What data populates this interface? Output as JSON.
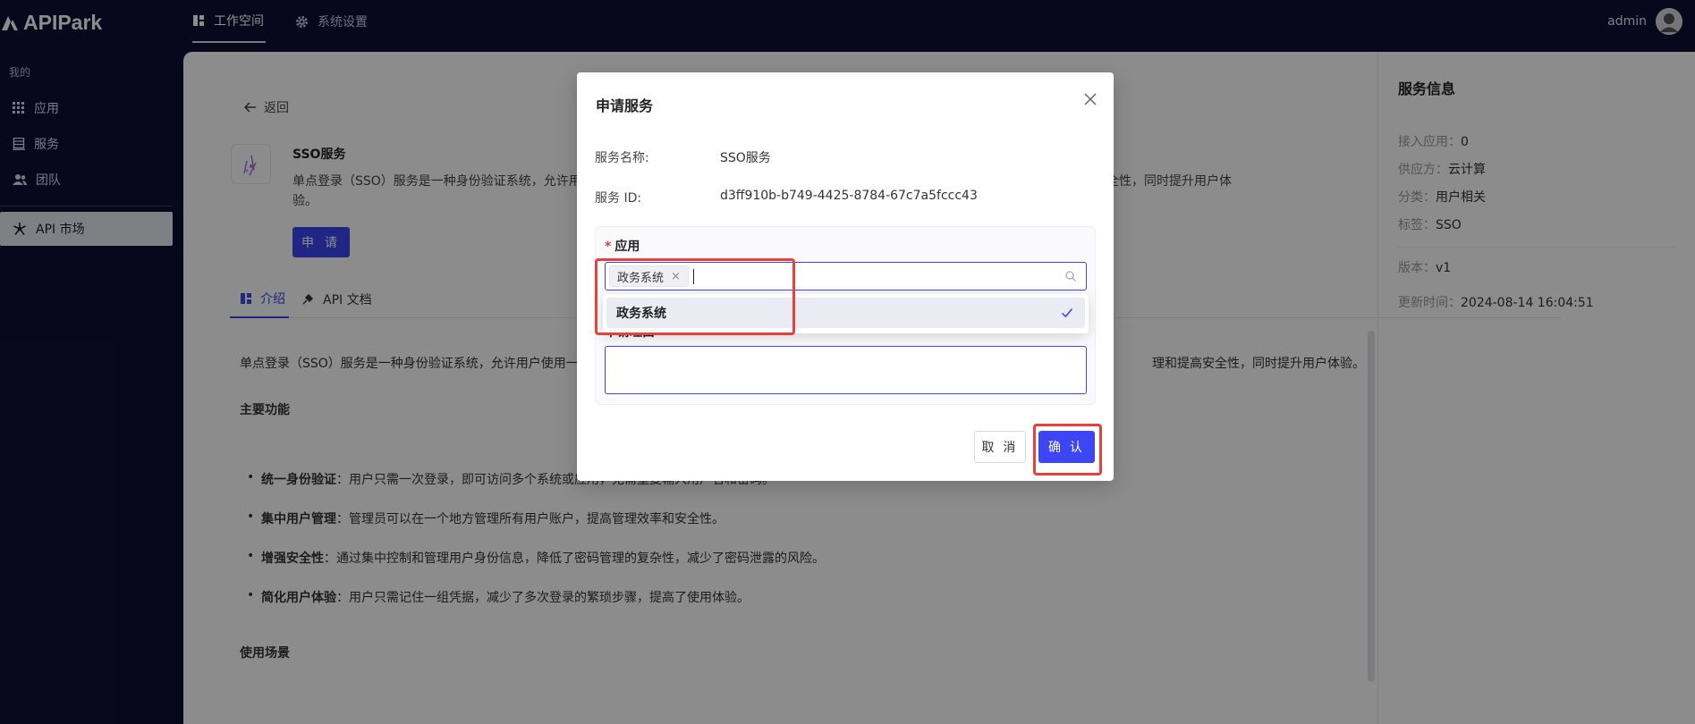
{
  "app": {
    "logo_text": "APIPark"
  },
  "topnav": {
    "items": [
      {
        "label": "工作空间",
        "icon": "dashboard-icon",
        "active": true
      },
      {
        "label": "系统设置",
        "icon": "gear-icon",
        "active": false
      }
    ],
    "user": "admin"
  },
  "sidebar": {
    "section": "我的",
    "items": [
      {
        "label": "应用",
        "icon": "grid-icon"
      },
      {
        "label": "服务",
        "icon": "service-icon"
      },
      {
        "label": "团队",
        "icon": "team-icon"
      },
      {
        "label": "API 市场",
        "icon": "market-icon",
        "active": true
      }
    ]
  },
  "main": {
    "back": "返回",
    "service": {
      "title": "SSO服务",
      "desc_left": "单点登录（SSO）服务是一种身份验证系统，允许用",
      "desc_right": "简化用户管理和提高安全性，同时提升用户体",
      "desc_line2": "验。",
      "apply_button": "申 请"
    },
    "tabs": [
      {
        "label": "介绍",
        "icon": "intro-icon",
        "active": true
      },
      {
        "label": "API 文档",
        "icon": "api-doc-icon",
        "active": false
      }
    ],
    "content": {
      "p1_left": "单点登录（SSO）服务是一种身份验证系统，允许用户使用一",
      "p1_right": "理和提高安全性，同时提升用户体验。",
      "heading_features": "主要功能",
      "bullets": [
        {
          "title": "统一身份验证",
          "text": "：用户只需一次登录，即可访问多个系统或应用，无需重复输入用户名和密码。"
        },
        {
          "title": "集中用户管理",
          "text": "：管理员可以在一个地方管理所有用户账户，提高管理效率和安全性。"
        },
        {
          "title": "增强安全性",
          "text": "：通过集中控制和管理用户身份信息，降低了密码管理的复杂性，减少了密码泄露的风险。"
        },
        {
          "title": "简化用户体验",
          "text": "：用户只需记住一组凭据，减少了多次登录的繁琐步骤，提高了使用体验。"
        }
      ],
      "heading_usage": "使用场景"
    }
  },
  "info_panel": {
    "title": "服务信息",
    "rows": [
      {
        "label": "接入应用：",
        "value": "0"
      },
      {
        "label": "供应方：",
        "value": "云计算"
      },
      {
        "label": "分类：",
        "value": "用户相关"
      },
      {
        "label": "标签：",
        "value": "SSO"
      }
    ],
    "rows2": [
      {
        "label": "版本：",
        "value": "v1"
      },
      {
        "label": "更新时间：",
        "value": "2024-08-14 16:04:51"
      }
    ]
  },
  "modal": {
    "title": "申请服务",
    "fields": [
      {
        "label": "服务名称:",
        "value": "SSO服务"
      },
      {
        "label": "服务 ID:",
        "value": "d3ff910b-b749-4425-8784-67c7a5fccc43"
      }
    ],
    "app_label": "应用",
    "required_mark": "*",
    "selected_tag": "政务系统",
    "tag_remove": "×",
    "dropdown_option": "政务系统",
    "second_label_partial": "申请理由",
    "cancel": "取 消",
    "confirm": "确 认"
  },
  "colors": {
    "primary": "#3d46f2",
    "nav_bg": "#0f1035",
    "highlight": "#e8403a"
  }
}
